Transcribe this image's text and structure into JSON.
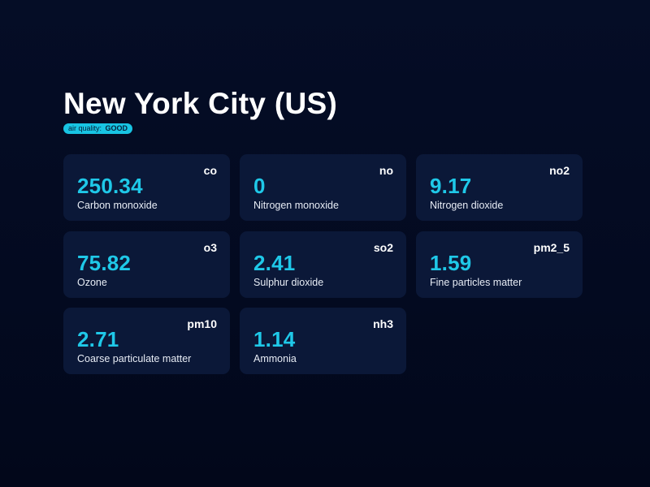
{
  "header": {
    "city": "New York City (US)",
    "air_quality_label": "air quality:",
    "air_quality_value": "GOOD"
  },
  "pollutants": [
    {
      "code": "co",
      "value": "250.34",
      "name": "Carbon monoxide"
    },
    {
      "code": "no",
      "value": "0",
      "name": "Nitrogen monoxide"
    },
    {
      "code": "no2",
      "value": "9.17",
      "name": "Nitrogen dioxide"
    },
    {
      "code": "o3",
      "value": "75.82",
      "name": "Ozone"
    },
    {
      "code": "so2",
      "value": "2.41",
      "name": "Sulphur dioxide"
    },
    {
      "code": "pm2_5",
      "value": "1.59",
      "name": "Fine particles matter"
    },
    {
      "code": "pm10",
      "value": "2.71",
      "name": "Coarse particulate matter"
    },
    {
      "code": "nh3",
      "value": "1.14",
      "name": "Ammonia"
    }
  ],
  "colors": {
    "background": "#040b22",
    "card": "#0b1838",
    "accent": "#1fc8e8",
    "badge": "#18c4e3"
  }
}
